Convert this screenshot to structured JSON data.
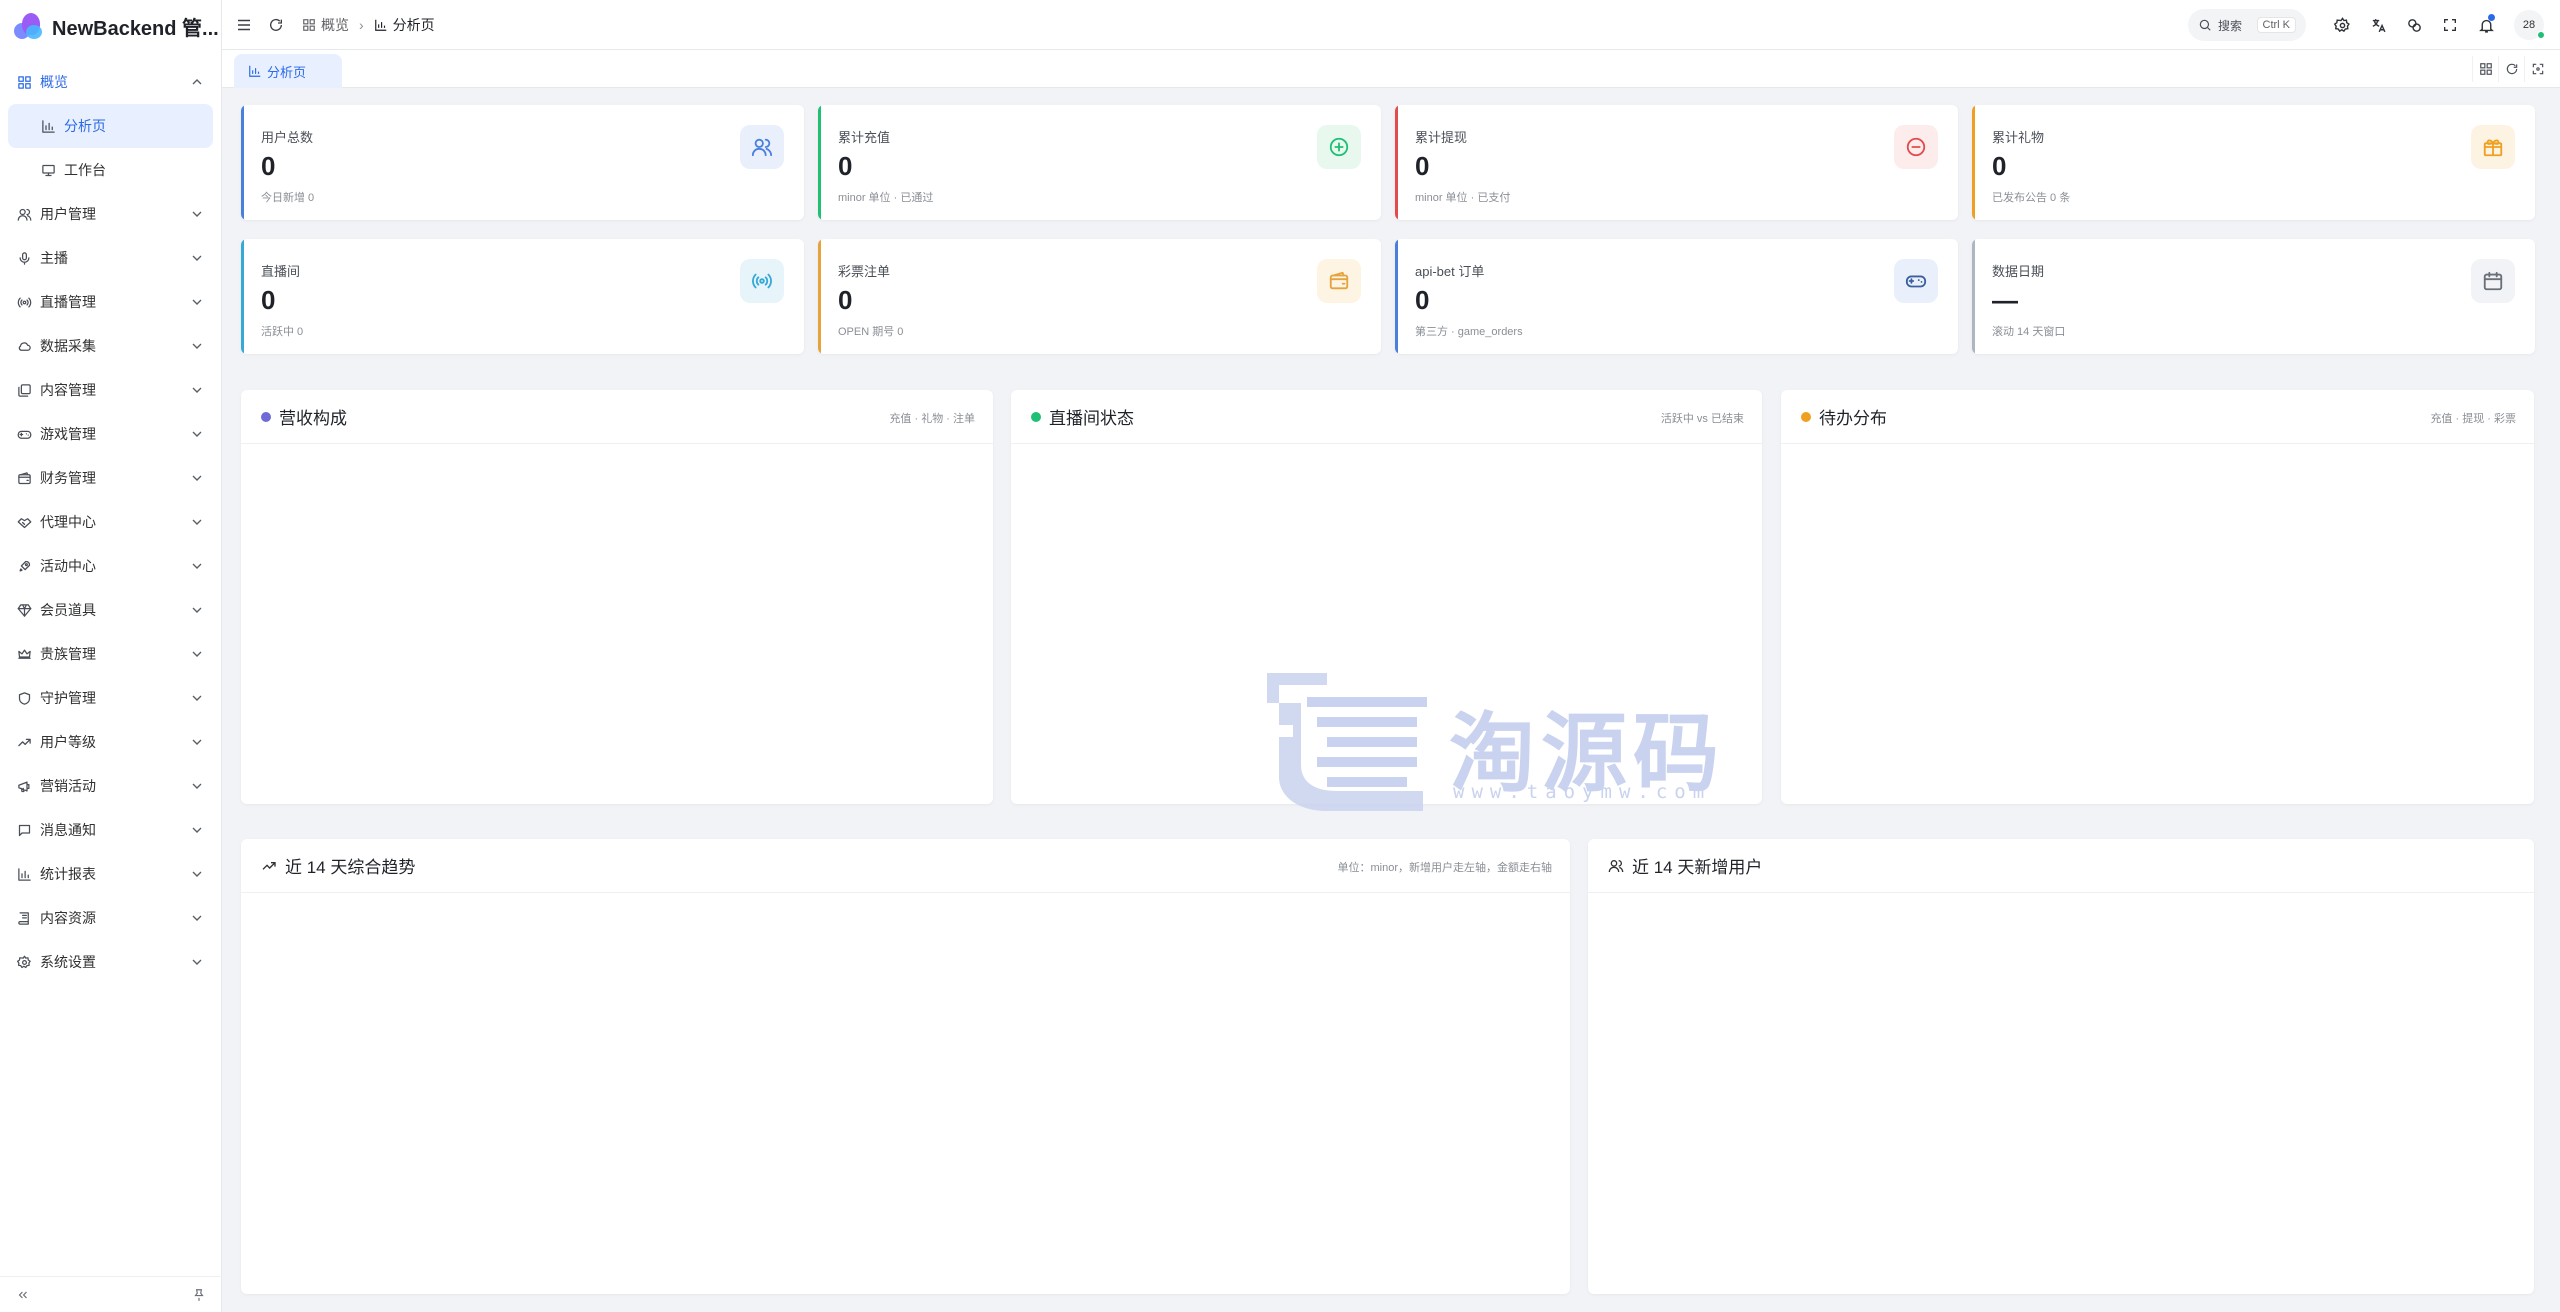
{
  "app": {
    "title": "NewBackend 管..."
  },
  "sidebar": {
    "menu": [
      {
        "label": "概览",
        "icon": "grid-icon",
        "open": true
      },
      {
        "label": "用户管理",
        "icon": "users-icon"
      },
      {
        "label": "主播",
        "icon": "mic-icon"
      },
      {
        "label": "直播管理",
        "icon": "broadcast-icon"
      },
      {
        "label": "数据采集",
        "icon": "cloud-icon"
      },
      {
        "label": "内容管理",
        "icon": "layers-icon"
      },
      {
        "label": "游戏管理",
        "icon": "gamepad-icon"
      },
      {
        "label": "财务管理",
        "icon": "wallet-icon"
      },
      {
        "label": "代理中心",
        "icon": "handshake-icon"
      },
      {
        "label": "活动中心",
        "icon": "rocket-icon"
      },
      {
        "label": "会员道具",
        "icon": "gem-icon"
      },
      {
        "label": "贵族管理",
        "icon": "crown-icon"
      },
      {
        "label": "守护管理",
        "icon": "shield-icon"
      },
      {
        "label": "用户等级",
        "icon": "trend-icon"
      },
      {
        "label": "营销活动",
        "icon": "megaphone-icon"
      },
      {
        "label": "消息通知",
        "icon": "message-icon"
      },
      {
        "label": "统计报表",
        "icon": "bar-chart-icon"
      },
      {
        "label": "内容资源",
        "icon": "book-icon"
      },
      {
        "label": "系统设置",
        "icon": "gear-icon"
      }
    ],
    "submenu": [
      {
        "label": "分析页",
        "icon": "chart-icon",
        "active": true
      },
      {
        "label": "工作台",
        "icon": "workbench-icon"
      }
    ]
  },
  "header": {
    "breadcrumb": [
      "概览",
      "分析页"
    ],
    "search": {
      "label": "搜索",
      "shortcut": "Ctrl K"
    },
    "avatar": "28"
  },
  "tabs": {
    "active": "分析页"
  },
  "stats": [
    {
      "label": "用户总数",
      "value": "0",
      "sub": "今日新增 0",
      "color": "#4a7fdc",
      "icon_color": "#4a7fdc",
      "icon_bg": "#e9f0fc",
      "icon": "users-icon"
    },
    {
      "label": "累计充值",
      "value": "0",
      "sub": "minor 单位 · 已通过",
      "color": "#1fbf75",
      "icon_color": "#1fbf75",
      "icon_bg": "#e8f8ef",
      "icon": "plus-circle-icon"
    },
    {
      "label": "累计提现",
      "value": "0",
      "sub": "minor 单位 · 已支付",
      "color": "#e24c4c",
      "icon_color": "#e24c4c",
      "icon_bg": "#fdecec",
      "icon": "minus-circle-icon"
    },
    {
      "label": "累计礼物",
      "value": "0",
      "sub": "已发布公告 0 条",
      "color": "#f0a020",
      "icon_color": "#f0a020",
      "icon_bg": "#fdf3e2",
      "icon": "gift-icon"
    },
    {
      "label": "直播间",
      "value": "0",
      "sub": "活跃中 0",
      "color": "#38a8d6",
      "icon_color": "#38a8d6",
      "icon_bg": "#e7f5fb",
      "icon": "broadcast-icon"
    },
    {
      "label": "彩票注单",
      "value": "0",
      "sub": "OPEN 期号 0",
      "color": "#e6a23c",
      "icon_color": "#e6a23c",
      "icon_bg": "#fdf4e4",
      "icon": "wallet-icon"
    },
    {
      "label": "api-bet 订单",
      "value": "0",
      "sub": "第三方 · game_orders",
      "color": "#4a7fdc",
      "icon_color": "#3b5f9e",
      "icon_bg": "#e9f0fc",
      "icon": "gamepad-icon"
    },
    {
      "label": "数据日期",
      "value": "—",
      "sub": "滚动 14 天窗口",
      "color": "#b0b6bf",
      "icon_color": "#6b7078",
      "icon_bg": "#f1f3f6",
      "icon": "calendar-icon"
    }
  ],
  "panels": {
    "revenue": {
      "title": "营收构成",
      "hint": "充值 · 礼物 · 注单",
      "dot": "#6f6ad6"
    },
    "live_status": {
      "title": "直播间状态",
      "hint": "活跃中 vs 已结束",
      "dot": "#1fbf75"
    },
    "todo": {
      "title": "待办分布",
      "hint": "充值 · 提现 · 彩票",
      "dot": "#f0a020"
    },
    "trend": {
      "title": "近 14 天综合趋势",
      "hint": "单位：minor，新增用户走左轴，金额走右轴"
    },
    "new_users": {
      "title": "近 14 天新增用户"
    }
  },
  "watermark": {
    "text": "淘源码",
    "url": "www.taoymw.com"
  }
}
